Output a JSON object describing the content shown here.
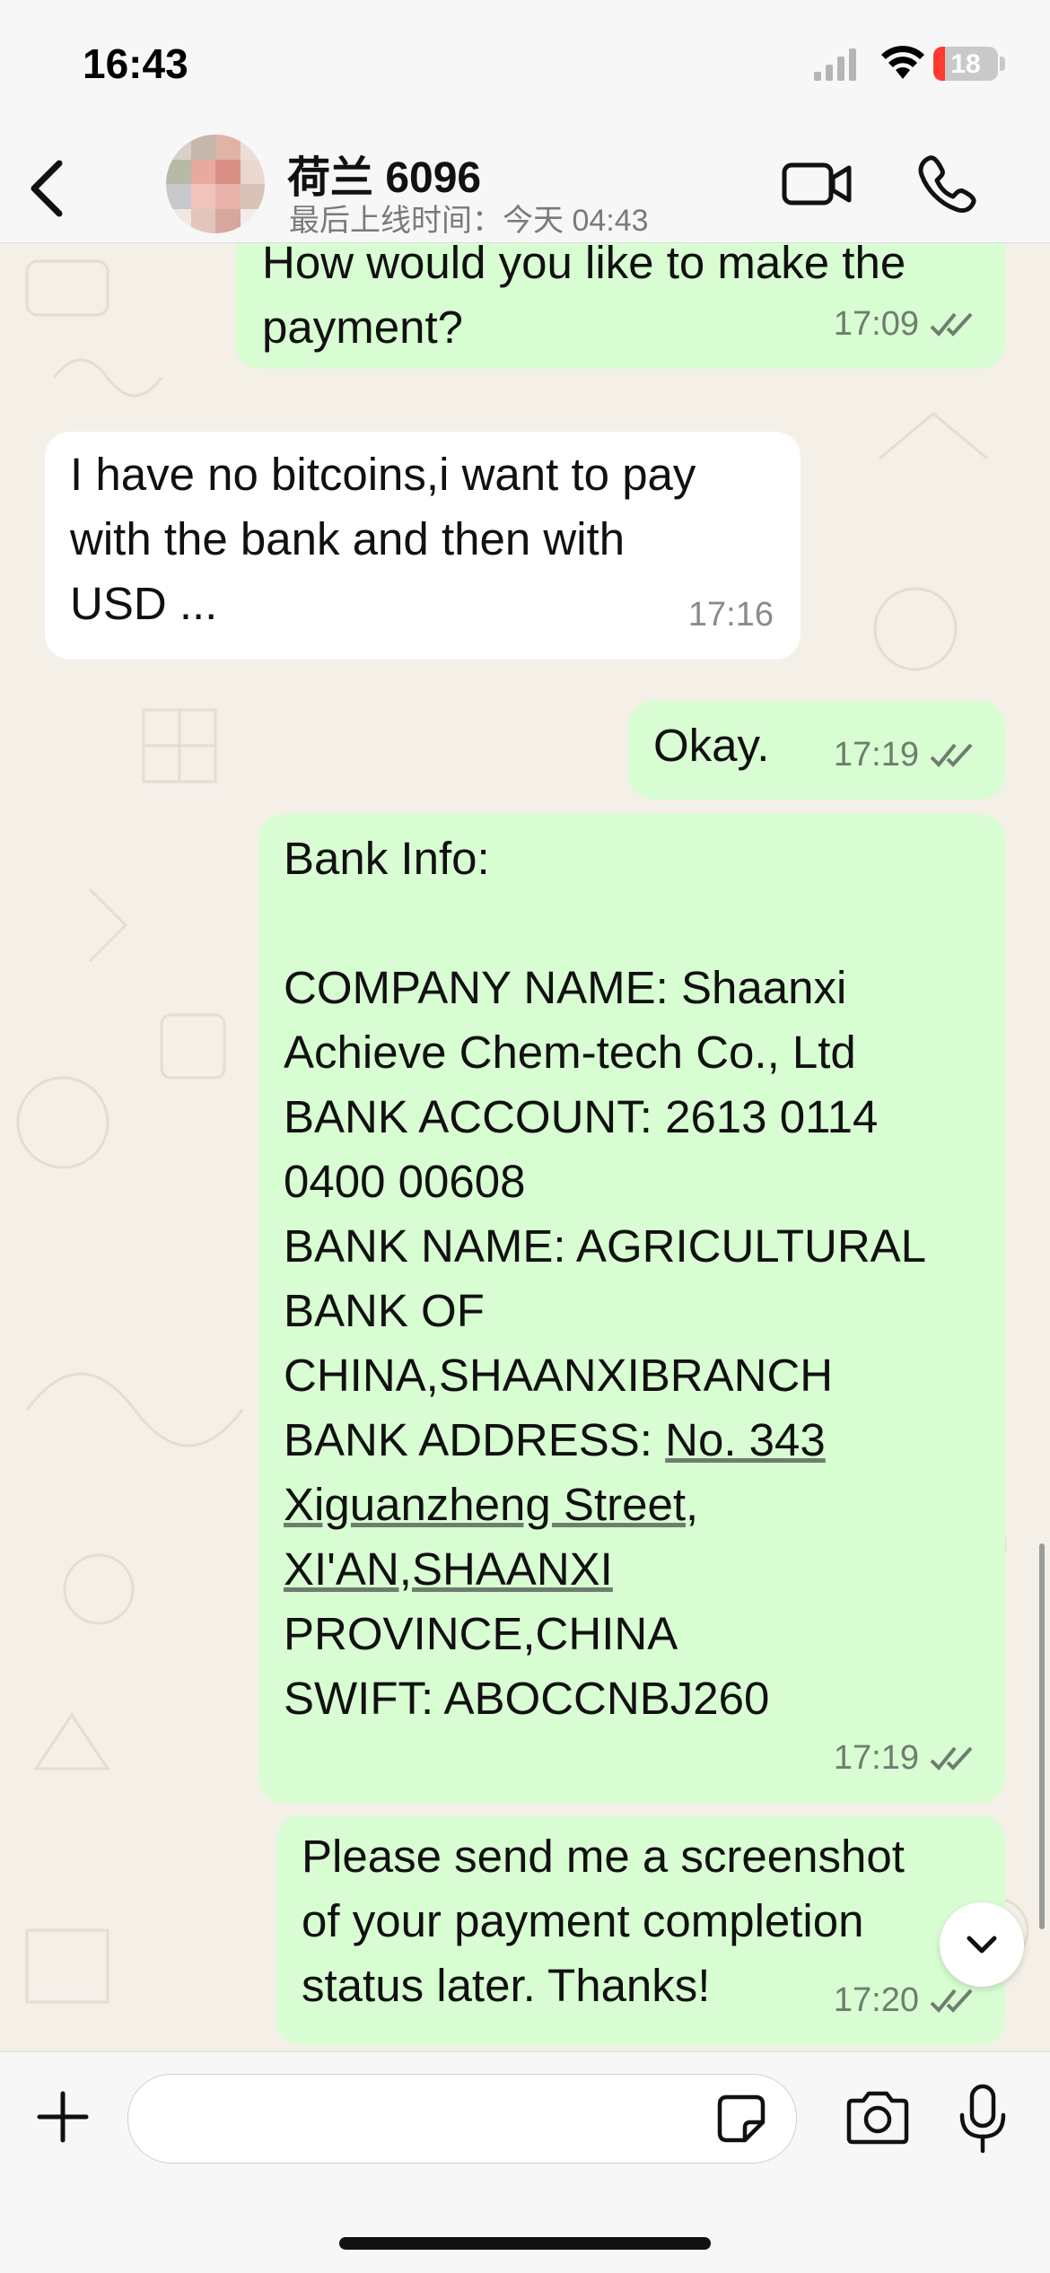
{
  "status_bar": {
    "time": "16:43",
    "battery": "18",
    "battery_level": 0.18
  },
  "header": {
    "contact_name": "荷兰 6096",
    "last_seen": "最后上线时间：今天 04:43"
  },
  "messages": [
    {
      "direction": "out",
      "text": "How would you like to make the\npayment?",
      "time": "17:09",
      "read": true
    },
    {
      "direction": "in",
      "text": "I have no bitcoins,i want to pay\nwith the bank and then with\nUSD ...",
      "time": "17:16"
    },
    {
      "direction": "out",
      "text": "Okay.",
      "time": "17:19",
      "read": true
    },
    {
      "direction": "out",
      "lines_before": "Bank Info:\n\nCOMPANY NAME: Shaanxi\nAchieve Chem-tech Co., Ltd\nBANK ACCOUNT: 2613 0114\n0400 00608\nBANK NAME: AGRICULTURAL\nBANK OF\nCHINA,SHAANXIBRANCH\nBANK ADDRESS: ",
      "link1": "No. 343",
      "link2": "Xiguanzheng Street",
      "comma": ",",
      "link3": "XI'AN,SHAANXI",
      "lines_after": "PROVINCE,CHINA\nSWIFT: ABOCCNBJ260",
      "time": "17:19",
      "read": true
    },
    {
      "direction": "out",
      "text": "Please send me a screenshot\nof your payment completion\nstatus later. Thanks!",
      "time": "17:20",
      "read": true
    }
  ],
  "colors": {
    "outgoing_bubble": "#d8fdd2",
    "incoming_bubble": "#ffffff",
    "read_tick": "#6f7d6f",
    "chat_background": "#f4efe7"
  },
  "icons": [
    "back-chevron-icon",
    "video-call-icon",
    "phone-call-icon",
    "plus-icon",
    "sticker-icon",
    "camera-icon",
    "microphone-icon",
    "scroll-down-chevron-icon"
  ]
}
